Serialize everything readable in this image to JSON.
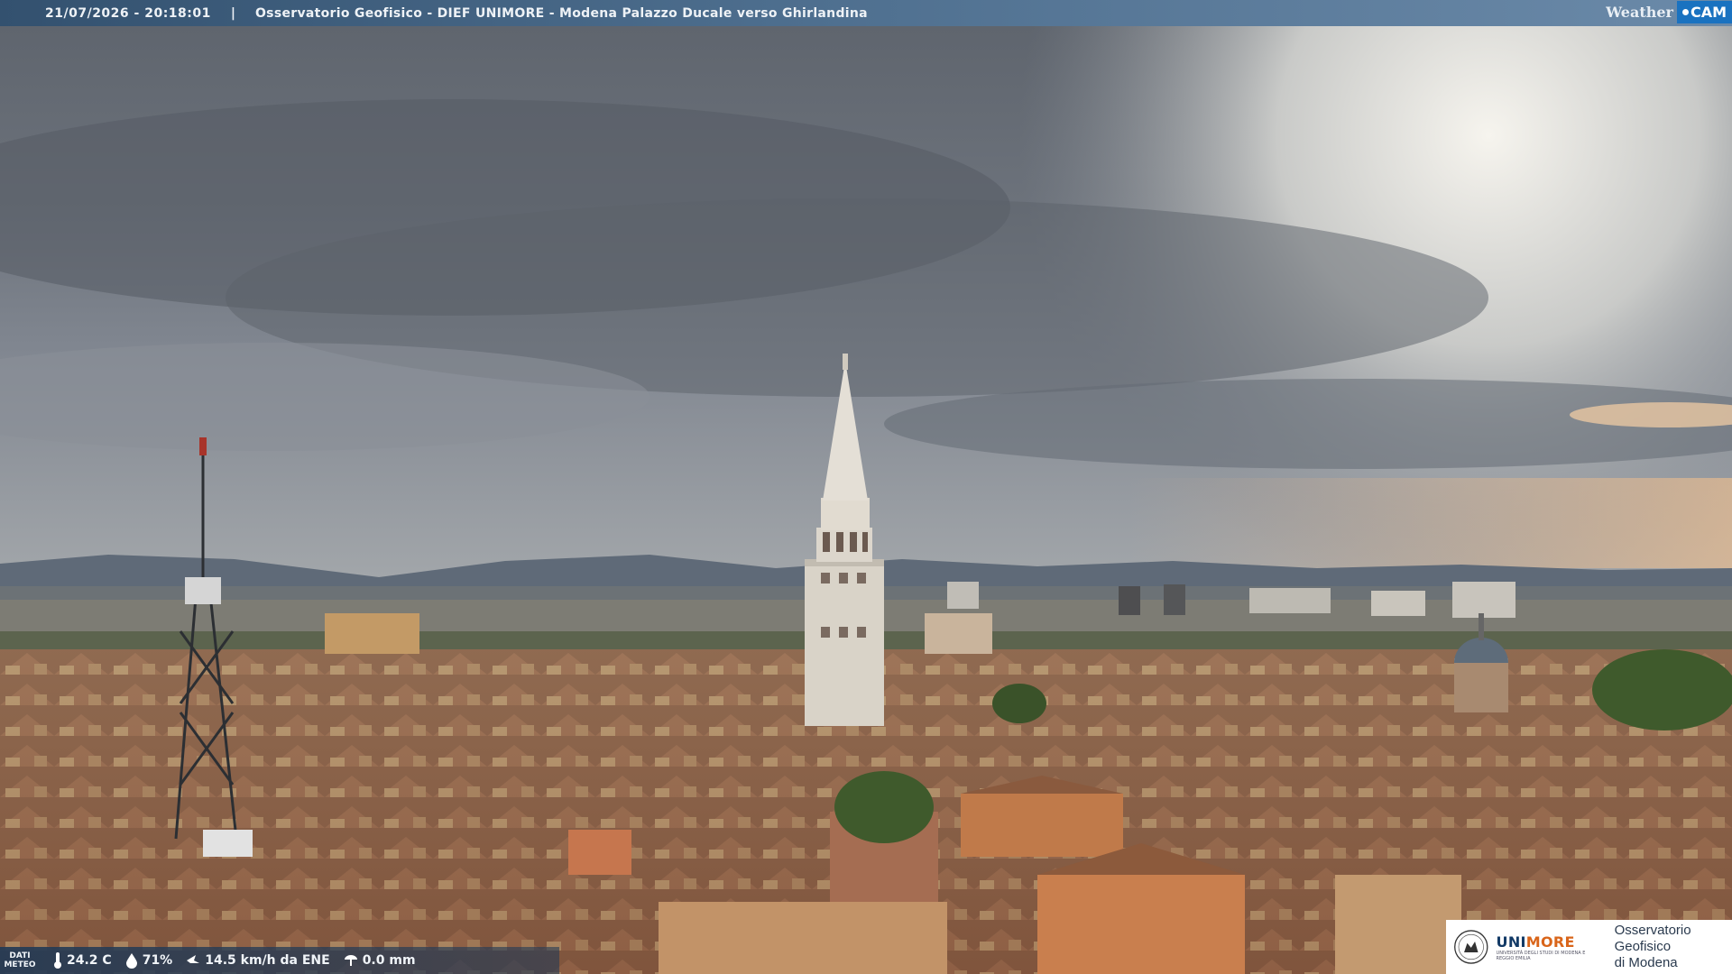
{
  "topbar": {
    "datetime": "21/07/2026 - 20:18:01",
    "separator": "|",
    "title": "Osservatorio Geofisico - DIEF UNIMORE - Modena Palazzo Ducale verso Ghirlandina",
    "logo_text_weather": "Weather",
    "logo_text_cam": "CAM"
  },
  "meteo": {
    "label_line1": "DATI",
    "label_line2": "METEO",
    "temperature": "24.2 C",
    "humidity": "71%",
    "wind": "14.5 km/h da ENE",
    "rain": "0.0 mm",
    "icons": [
      "thermometer-icon",
      "humidity-drop-icon",
      "wind-icon",
      "rain-gauge-icon"
    ]
  },
  "partner": {
    "brand_a": "UNI",
    "brand_b": "MORE",
    "brand_sub": "UNIVERSITÀ DEGLI STUDI DI MODENA E REGGIO EMILIA",
    "observatory_line1": "Osservatorio Geofisico",
    "observatory_line2": "di Modena"
  },
  "colors": {
    "bar": "#3e5f80",
    "accent_blue": "#1a72c0",
    "accent_orange": "#d9651a"
  }
}
